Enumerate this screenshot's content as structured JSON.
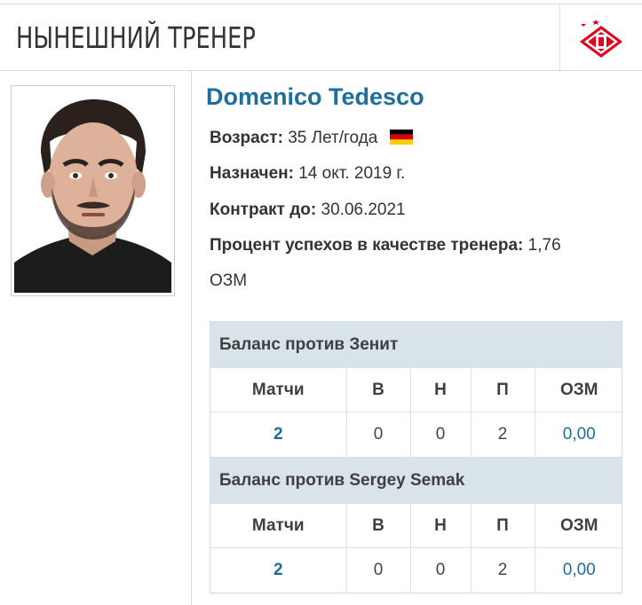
{
  "header": {
    "title": "НЫНЕШНИЙ ТРЕНЕР",
    "logo_icon": "spartak-club-logo-icon",
    "logo_color": "#e2001a"
  },
  "coach": {
    "photo_icon": "coach-photo",
    "name": "Domenico Tedesco",
    "age_label": "Возраст:",
    "age_value": "35 Лет/года",
    "flag_icon": "germany-flag-icon",
    "appointed_label": "Назначен:",
    "appointed_value": "14 окт. 2019 г.",
    "contract_label": "Контракт до:",
    "contract_value": "30.06.2021",
    "success_label": "Процент успехов в качестве тренера:",
    "success_value": "1,76",
    "success_unit": "ОЗМ"
  },
  "balances": [
    {
      "title": "Баланс против Зенит",
      "columns": [
        "Матчи",
        "В",
        "Н",
        "П",
        "ОЗМ"
      ],
      "row": [
        "2",
        "0",
        "0",
        "2",
        "0,00"
      ]
    },
    {
      "title": "Баланс против Sergey Semak",
      "columns": [
        "Матчи",
        "В",
        "Н",
        "П",
        "ОЗМ"
      ],
      "row": [
        "2",
        "0",
        "0",
        "2",
        "0,00"
      ]
    }
  ],
  "colors": {
    "name_link": "#1e6e9c",
    "table_header_bg": "#d8e3ea",
    "border": "#dcdcdc"
  }
}
